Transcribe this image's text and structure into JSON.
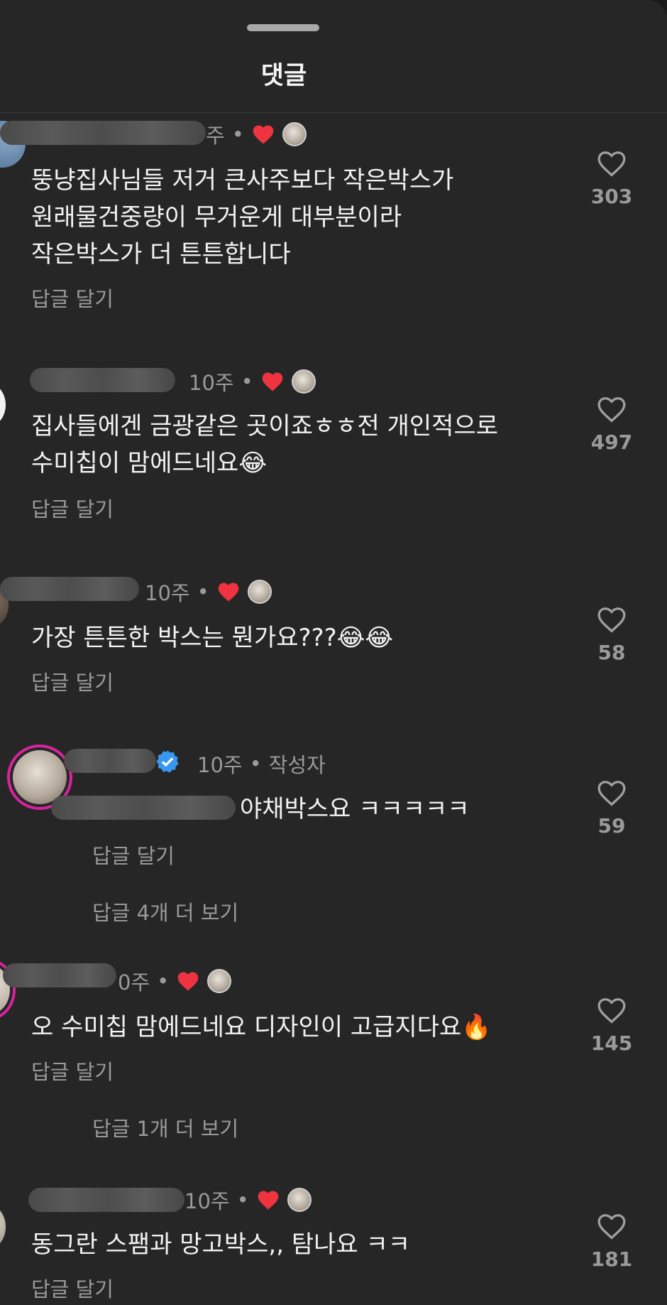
{
  "sheet": {
    "title": "댓글"
  },
  "common": {
    "reply_label": "답글 달기",
    "author_label": "작성자"
  },
  "comments": [
    {
      "time": "주",
      "text": "뚱냥집사님들 저거 큰사주보다 작은박스가\n원래물건중량이 무거운게 대부분이라\n작은박스가 더 튼튼합니다",
      "likes": "303"
    },
    {
      "time": "10주",
      "text": "집사들에겐 금광같은 곳이죠ㅎㅎ전 개인적으로\n수미칩이 맘에드네요😂",
      "likes": "497"
    },
    {
      "time": "10주",
      "text": "가장 튼튼한 박스는 뭔가요???😂😂",
      "likes": "58"
    },
    {
      "time": "10주",
      "text": "야채박스요 ㅋㅋㅋㅋㅋ",
      "likes": "59",
      "more_replies": "답글 4개 더 보기"
    },
    {
      "time": "0주",
      "text": "오 수미칩 맘에드네요  디자인이 고급지다요🔥",
      "likes": "145",
      "more_replies": "답글 1개 더 보기"
    },
    {
      "time": "10주",
      "text": "동그란 스팸과 망고박스,, 탐나요 ㅋㅋ",
      "likes": "181"
    }
  ]
}
